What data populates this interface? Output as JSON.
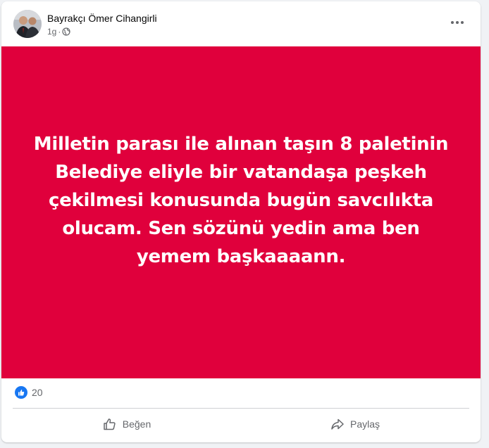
{
  "colors": {
    "post_background": "#e0003c",
    "like_blue": "#1877f2",
    "secondary_text": "#65676b"
  },
  "post": {
    "author": "Bayrakçı Ömer Cihangirli",
    "time": "1g",
    "separator": "·",
    "privacy_icon": "globe-icon",
    "text": "Milletin parası ile alınan taşın 8 paletinin Belediye eliyle bir vatandaşa peşkeh çekilmesi konusunda bugün savcılıkta olucam. Sen sözünü yedin ama ben yemem başkaaaann."
  },
  "reactions": {
    "icon": "like-icon",
    "count": "20"
  },
  "actions": {
    "like_label": "Beğen",
    "share_label": "Paylaş"
  }
}
